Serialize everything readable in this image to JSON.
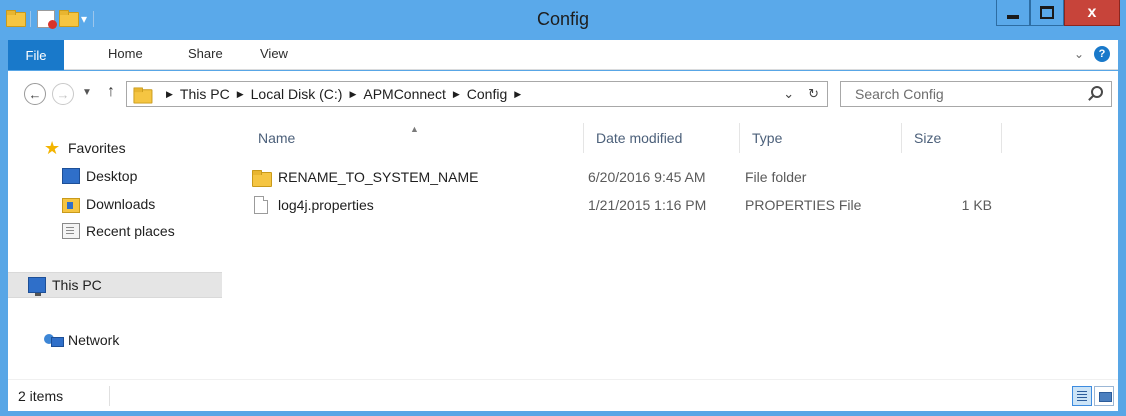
{
  "window": {
    "title": "Config",
    "controls": {
      "minimize": "minimize",
      "maximize": "maximize",
      "close": "x"
    }
  },
  "ribbon": {
    "tabs": [
      "File",
      "Home",
      "Share",
      "View"
    ],
    "help": "?"
  },
  "address": {
    "crumbs": [
      "This PC",
      "Local Disk (C:)",
      "APMConnect",
      "Config"
    ]
  },
  "search": {
    "placeholder": "Search Config"
  },
  "nav_pane": {
    "favorites": "Favorites",
    "desktop": "Desktop",
    "downloads": "Downloads",
    "recent": "Recent places",
    "this_pc": "This PC",
    "network": "Network"
  },
  "columns": {
    "name": "Name",
    "date": "Date modified",
    "type": "Type",
    "size": "Size"
  },
  "files": [
    {
      "name": "RENAME_TO_SYSTEM_NAME",
      "date": "6/20/2016 9:45 AM",
      "type": "File folder",
      "size": "",
      "icon": "folder-icon"
    },
    {
      "name": "log4j.properties",
      "date": "1/21/2015 1:16 PM",
      "type": "PROPERTIES File",
      "size": "1 KB",
      "icon": "file-icon"
    }
  ],
  "status": {
    "items": "2 items"
  }
}
